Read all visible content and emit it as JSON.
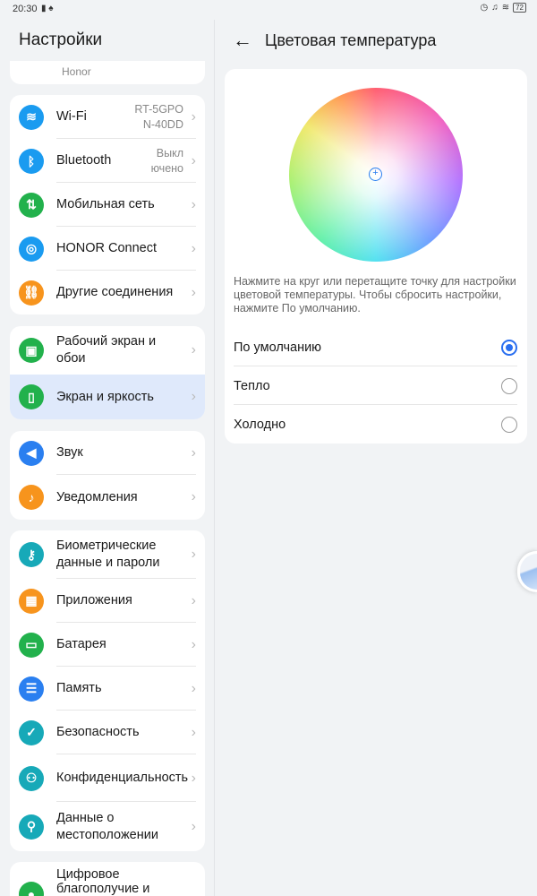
{
  "status": {
    "time": "20:30",
    "battery": "72",
    "icons_left": [
      "battery-saver-icon",
      "notification-bell-icon"
    ],
    "icons_right": [
      "data-saver-icon",
      "mute-icon",
      "wifi-icon",
      "battery-icon"
    ]
  },
  "left": {
    "title": "Настройки",
    "clipped_text": "Honor",
    "groups": [
      {
        "items": [
          {
            "id": "wifi",
            "label": "Wi-Fi",
            "value": "RT-5GPO N-40DD",
            "icon": "wifi-icon",
            "color": "#1a9bf0",
            "glyph": "≋"
          },
          {
            "id": "bluetooth",
            "label": "Bluetooth",
            "value": "Выкл ючено",
            "icon": "bluetooth-icon",
            "color": "#1a9bf0",
            "glyph": "ᛒ"
          },
          {
            "id": "mobile",
            "label": "Мобильная сеть",
            "icon": "mobile-network-icon",
            "color": "#22b14c",
            "glyph": "⇅"
          },
          {
            "id": "honor-connect",
            "label": "HONOR Connect",
            "icon": "honor-connect-icon",
            "color": "#1a9bf0",
            "glyph": "◎"
          },
          {
            "id": "other",
            "label": "Другие соединения",
            "icon": "link-icon",
            "color": "#f7941d",
            "glyph": "⛓"
          }
        ]
      },
      {
        "items": [
          {
            "id": "home",
            "label": "Рабочий экран и обои",
            "icon": "wallpaper-icon",
            "color": "#22b14c",
            "glyph": "▣"
          },
          {
            "id": "display",
            "label": "Экран и яркость",
            "icon": "display-icon",
            "color": "#22b14c",
            "glyph": "▯",
            "selected": true
          }
        ]
      },
      {
        "items": [
          {
            "id": "sound",
            "label": "Звук",
            "icon": "speaker-icon",
            "color": "#2a7ff0",
            "glyph": "◀"
          },
          {
            "id": "notifications",
            "label": "Уведомления",
            "icon": "bell-icon",
            "color": "#f7941d",
            "glyph": "♪"
          }
        ]
      },
      {
        "items": [
          {
            "id": "biometrics",
            "label": "Биометрические данные и пароли",
            "icon": "key-icon",
            "color": "#17a9b8",
            "glyph": "⚷"
          },
          {
            "id": "apps",
            "label": "Приложения",
            "icon": "apps-icon",
            "color": "#f7941d",
            "glyph": "▦"
          },
          {
            "id": "battery",
            "label": "Батарея",
            "icon": "battery-icon",
            "color": "#22b14c",
            "glyph": "▭"
          },
          {
            "id": "storage",
            "label": "Память",
            "icon": "storage-icon",
            "color": "#2a7ff0",
            "glyph": "☰"
          },
          {
            "id": "security",
            "label": "Безопасность",
            "icon": "shield-icon",
            "color": "#17a9b8",
            "glyph": "✓"
          },
          {
            "id": "privacy",
            "label": "Конфиденциальность",
            "icon": "privacy-icon",
            "color": "#17a9b8",
            "glyph": "⚇"
          },
          {
            "id": "location",
            "label": "Данные о местоположении",
            "icon": "location-icon",
            "color": "#17a9b8",
            "glyph": "⚲"
          }
        ]
      },
      {
        "items": [
          {
            "id": "digital",
            "label": "Цифровое благополучие и",
            "icon": "wellbeing-icon",
            "color": "#22b14c",
            "glyph": "●"
          }
        ]
      }
    ]
  },
  "right": {
    "title": "Цветовая температура",
    "hint": "Нажмите на круг или перетащите точку для настройки цветовой температуры. Чтобы сбросить настройки, нажмите По умолчанию.",
    "options": [
      {
        "label": "По умолчанию",
        "selected": true
      },
      {
        "label": "Тепло",
        "selected": false
      },
      {
        "label": "Холодно",
        "selected": false
      }
    ]
  }
}
